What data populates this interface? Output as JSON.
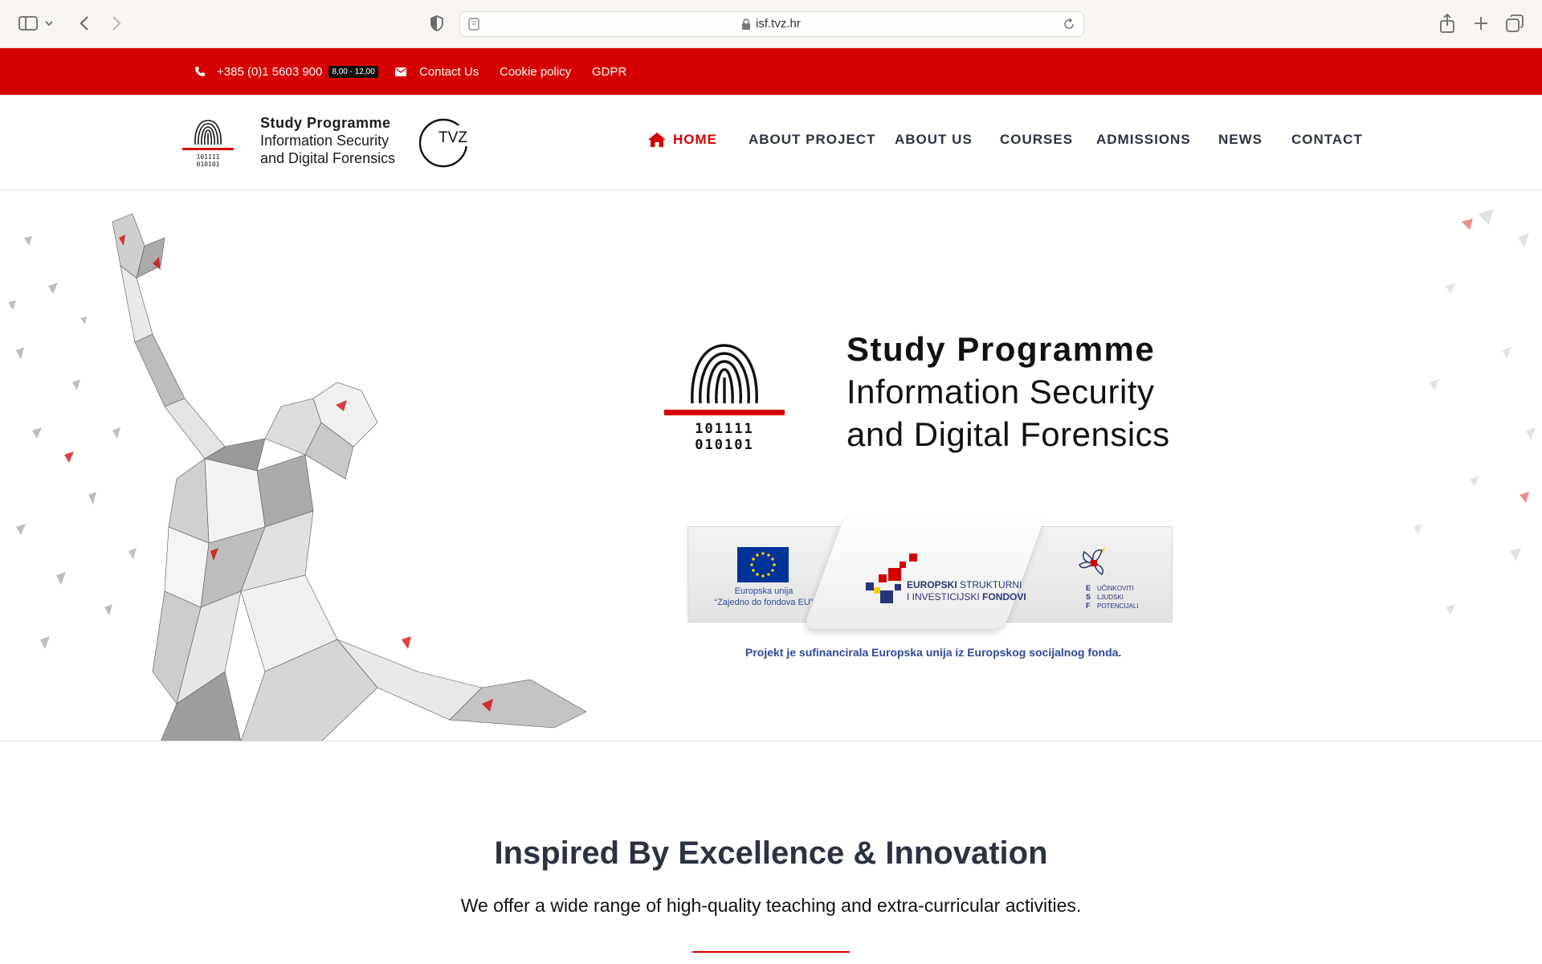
{
  "browser": {
    "url": "isf.tvz.hr"
  },
  "topbar": {
    "phone": "+385 (0)1 5603 900",
    "hours": "8,00 - 12,00",
    "contact_label": "Contact Us",
    "cookie_label": "Cookie policy",
    "gdpr_label": "GDPR"
  },
  "header": {
    "logo_line1": "Study Programme",
    "logo_line2": "Information Security",
    "logo_line3": "and Digital Forensics",
    "logo_binary1": "101111",
    "logo_binary2": "010101",
    "tvz_logo": "TVZ"
  },
  "nav": {
    "items": [
      {
        "label": "HOME",
        "active": true
      },
      {
        "label": "ABOUT PROJECT"
      },
      {
        "label": "ABOUT US"
      },
      {
        "label": "COURSES"
      },
      {
        "label": "ADMISSIONS"
      },
      {
        "label": "NEWS"
      },
      {
        "label": "CONTACT"
      }
    ]
  },
  "hero": {
    "title_line1": "Study Programme",
    "title_line2": "Information Security",
    "title_line3": "and Digital Forensics",
    "binary1": "101111",
    "binary2": "010101",
    "eu": {
      "union_line1": "Europska unija",
      "union_line2": "“Zajedno do fondova EU”",
      "esif_line1_bold": "EUROPSKI",
      "esif_line1_rest": " STRUKTURNI",
      "esif_line2_rest": "I INVESTICIJSKI ",
      "esif_line2_bold": "FONDOVI",
      "esf_letters": "E\nS\nF",
      "esf_line1": "UČINKOVITI",
      "esf_line2": "LJUDSKI",
      "esf_line3": "POTENCIJALI",
      "caption": "Projekt je sufinancirala Europska unija iz Europskog socijalnog fonda."
    }
  },
  "intro": {
    "title": "Inspired By Excellence & Innovation",
    "subtitle": "We offer a wide range of high-quality teaching and extra-curricular activities."
  },
  "colors": {
    "brand_red": "#d50000",
    "nav_text": "#2b3242",
    "eu_blue": "#003399"
  }
}
